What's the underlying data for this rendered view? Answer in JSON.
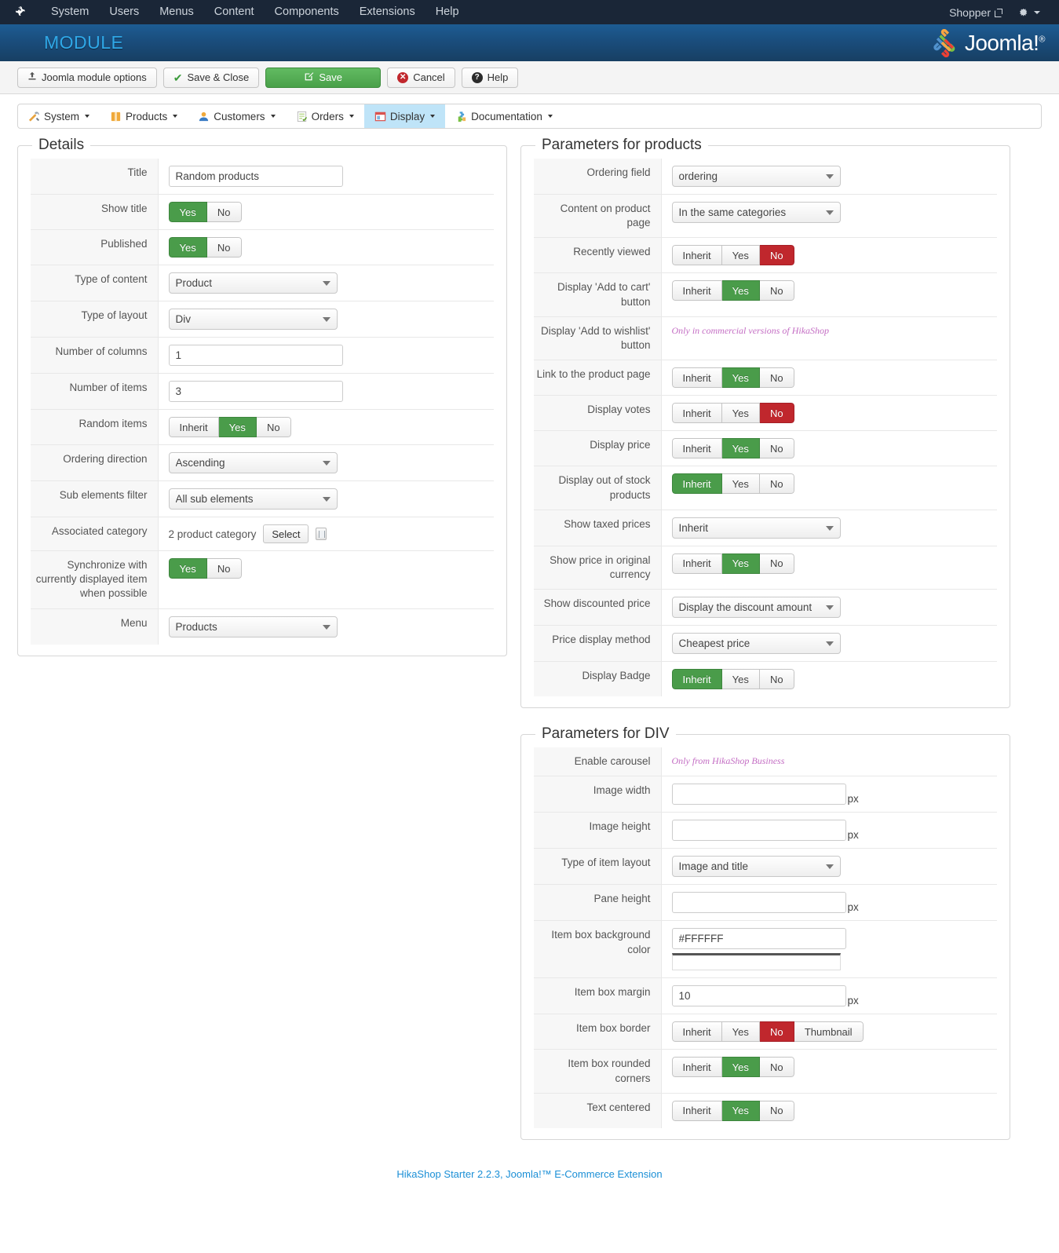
{
  "topbar": {
    "logo_icon": "joomla-logo-icon",
    "nav": [
      {
        "label": "System"
      },
      {
        "label": "Users"
      },
      {
        "label": "Menus"
      },
      {
        "label": "Content"
      },
      {
        "label": "Components"
      },
      {
        "label": "Extensions"
      },
      {
        "label": "Help"
      }
    ],
    "user_label": "Shopper",
    "external_link_icon": "external-link-icon",
    "gear_icon": "gear-icon"
  },
  "header": {
    "title": "MODULE",
    "brand": "Joomla!",
    "brand_tm": "®",
    "title_color": "#2fa8e8"
  },
  "toolbar": {
    "joomla_options_label": "Joomla module options",
    "save_close_label": "Save & Close",
    "save_label": "Save",
    "cancel_label": "Cancel",
    "help_label": "Help",
    "save_color": "#4aa04a",
    "cancel_color": "#c1272d"
  },
  "submenu": {
    "items": [
      {
        "label": "System",
        "icon": "wrench-screwdriver-icon",
        "active": false
      },
      {
        "label": "Products",
        "icon": "box-icon",
        "active": false
      },
      {
        "label": "Customers",
        "icon": "user-icon",
        "active": false
      },
      {
        "label": "Orders",
        "icon": "invoice-icon",
        "active": false
      },
      {
        "label": "Display",
        "icon": "window-icon",
        "active": true
      },
      {
        "label": "Documentation",
        "icon": "puzzle-icon",
        "active": false
      }
    ],
    "active_bg": "#bfe4f8"
  },
  "details": {
    "legend": "Details",
    "rows": [
      {
        "label": "Title",
        "type": "text",
        "value": "Random products"
      },
      {
        "label": "Show title",
        "type": "toggle2",
        "options": [
          "Yes",
          "No"
        ],
        "selected": "Yes",
        "state": "green"
      },
      {
        "label": "Published",
        "type": "toggle2",
        "options": [
          "Yes",
          "No"
        ],
        "selected": "Yes",
        "state": "green"
      },
      {
        "label": "Type of content",
        "type": "select",
        "value": "Product"
      },
      {
        "label": "Type of layout",
        "type": "select",
        "value": "Div"
      },
      {
        "label": "Number of columns",
        "type": "text",
        "value": "1"
      },
      {
        "label": "Number of items",
        "type": "text",
        "value": "3"
      },
      {
        "label": "Random items",
        "type": "toggle3",
        "options": [
          "Inherit",
          "Yes",
          "No"
        ],
        "selected": "Yes",
        "state": "green"
      },
      {
        "label": "Ordering direction",
        "type": "select",
        "value": "Ascending"
      },
      {
        "label": "Sub elements filter",
        "type": "select",
        "value": "All sub elements"
      },
      {
        "label": "Associated category",
        "type": "category",
        "value": "2 product category",
        "button": "Select",
        "delete_icon": "trash-icon"
      },
      {
        "label": "Synchronize with currently displayed item when possible",
        "type": "toggle2",
        "options": [
          "Yes",
          "No"
        ],
        "selected": "Yes",
        "state": "green"
      },
      {
        "label": "Menu",
        "type": "select",
        "value": "Products"
      }
    ]
  },
  "products_params": {
    "legend": "Parameters for products",
    "rows": [
      {
        "label": "Ordering field",
        "type": "select",
        "value": "ordering"
      },
      {
        "label": "Content on product page",
        "type": "select",
        "value": "In the same categories"
      },
      {
        "label": "Recently viewed",
        "type": "toggle3",
        "options": [
          "Inherit",
          "Yes",
          "No"
        ],
        "selected": "No",
        "state": "red"
      },
      {
        "label": "Display 'Add to cart' button",
        "type": "toggle3",
        "options": [
          "Inherit",
          "Yes",
          "No"
        ],
        "selected": "Yes",
        "state": "green"
      },
      {
        "label": "Display 'Add to wishlist' button",
        "type": "note",
        "value": "Only in commercial versions of HikaShop"
      },
      {
        "label": "Link to the product page",
        "type": "toggle3",
        "options": [
          "Inherit",
          "Yes",
          "No"
        ],
        "selected": "Yes",
        "state": "green"
      },
      {
        "label": "Display votes",
        "type": "toggle3",
        "options": [
          "Inherit",
          "Yes",
          "No"
        ],
        "selected": "No",
        "state": "red"
      },
      {
        "label": "Display price",
        "type": "toggle3",
        "options": [
          "Inherit",
          "Yes",
          "No"
        ],
        "selected": "Yes",
        "state": "green"
      },
      {
        "label": "Display out of stock products",
        "type": "toggle3",
        "options": [
          "Inherit",
          "Yes",
          "No"
        ],
        "selected": "Inherit",
        "state": "green"
      },
      {
        "label": "Show taxed prices",
        "type": "select",
        "value": "Inherit"
      },
      {
        "label": "Show price in original currency",
        "type": "toggle3",
        "options": [
          "Inherit",
          "Yes",
          "No"
        ],
        "selected": "Yes",
        "state": "green"
      },
      {
        "label": "Show discounted price",
        "type": "select",
        "value": "Display the discount amount"
      },
      {
        "label": "Price display method",
        "type": "select",
        "value": "Cheapest price"
      },
      {
        "label": "Display Badge",
        "type": "toggle3",
        "options": [
          "Inherit",
          "Yes",
          "No"
        ],
        "selected": "Inherit",
        "state": "green"
      }
    ]
  },
  "div_params": {
    "legend": "Parameters for DIV",
    "rows": [
      {
        "label": "Enable carousel",
        "type": "note",
        "value": "Only from HikaShop Business"
      },
      {
        "label": "Image width",
        "type": "text_unit",
        "value": "",
        "unit": "px"
      },
      {
        "label": "Image height",
        "type": "text_unit",
        "value": "",
        "unit": "px"
      },
      {
        "label": "Type of item layout",
        "type": "select",
        "value": "Image and title"
      },
      {
        "label": "Pane height",
        "type": "text_unit",
        "value": "",
        "unit": "px"
      },
      {
        "label": "Item box background color",
        "type": "color",
        "value": "#FFFFFF",
        "swatch": "#FFFFFF"
      },
      {
        "label": "Item box margin",
        "type": "text_unit",
        "value": "10",
        "unit": "px"
      },
      {
        "label": "Item box border",
        "type": "toggle4",
        "options": [
          "Inherit",
          "Yes",
          "No",
          "Thumbnail"
        ],
        "selected": "No",
        "state": "red"
      },
      {
        "label": "Item box rounded corners",
        "type": "toggle3",
        "options": [
          "Inherit",
          "Yes",
          "No"
        ],
        "selected": "Yes",
        "state": "green"
      },
      {
        "label": "Text centered",
        "type": "toggle3",
        "options": [
          "Inherit",
          "Yes",
          "No"
        ],
        "selected": "Yes",
        "state": "green"
      }
    ]
  },
  "footer": {
    "text": "HikaShop Starter 2.2.3, Joomla!™ E-Commerce Extension",
    "color": "#1b8fd6"
  }
}
